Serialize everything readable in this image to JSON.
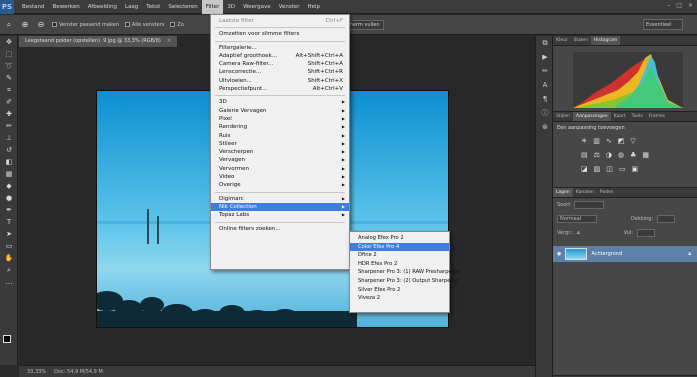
{
  "app": {
    "logo": "PS"
  },
  "menubar": {
    "items": [
      "Bestand",
      "Bewerken",
      "Afbeelding",
      "Laag",
      "Tekst",
      "Selecteren",
      "Filter",
      "3D",
      "Weergave",
      "Venster",
      "Help"
    ],
    "active_index": 6
  },
  "options": {
    "check1": "Venster passend maken",
    "check2": "Alle vensters",
    "check3": "Zo",
    "button": "Scherm vullen",
    "workspace": "Essentieel"
  },
  "document": {
    "tab_title": "Leegstaand polder (opstellen). 9 jpg @ 33,3% (RGB/8)",
    "tab_close": "×"
  },
  "status": {
    "zoom": "33,33%",
    "doc": "Doc: 54,9 M/54,9 M"
  },
  "filter_menu": {
    "items": [
      {
        "label": "Laatste filter",
        "shortcut": "Ctrl+F",
        "disabled": true
      },
      {
        "sep": true
      },
      {
        "label": "Omzetten voor slimme filters"
      },
      {
        "sep": true
      },
      {
        "label": "Filtergalerie..."
      },
      {
        "label": "Adaptief groothoek...",
        "shortcut": "Alt+Shift+Ctrl+A"
      },
      {
        "label": "Camera Raw-filter...",
        "shortcut": "Shift+Ctrl+A"
      },
      {
        "label": "Lenscorrectie...",
        "shortcut": "Shift+Ctrl+R"
      },
      {
        "label": "Uitvloeien...",
        "shortcut": "Shift+Ctrl+X"
      },
      {
        "label": "Perspectiefpunt...",
        "shortcut": "Alt+Ctrl+V"
      },
      {
        "sep": true
      },
      {
        "label": "3D",
        "submenu": true
      },
      {
        "label": "Galerie Vervagen",
        "submenu": true
      },
      {
        "label": "Pixel",
        "submenu": true
      },
      {
        "label": "Rendering",
        "submenu": true
      },
      {
        "label": "Ruis",
        "submenu": true
      },
      {
        "label": "Stileer",
        "submenu": true
      },
      {
        "label": "Verscherpen",
        "submenu": true
      },
      {
        "label": "Vervagen",
        "submenu": true
      },
      {
        "label": "Vervormen",
        "submenu": true
      },
      {
        "label": "Video",
        "submenu": true
      },
      {
        "label": "Overige",
        "submenu": true
      },
      {
        "sep": true
      },
      {
        "label": "Digimarc",
        "submenu": true
      },
      {
        "label": "Nik Collection",
        "submenu": true,
        "highlighted": true
      },
      {
        "label": "Topaz Labs",
        "submenu": true
      },
      {
        "sep": true
      },
      {
        "label": "Online filters zoeken..."
      }
    ]
  },
  "nik_submenu": {
    "items": [
      {
        "label": "Analog Efex Pro 2"
      },
      {
        "label": "Color Efex Pro 4",
        "highlighted": true
      },
      {
        "label": "Dfine 2"
      },
      {
        "label": "HDR Efex Pro 2"
      },
      {
        "label": "Sharpener Pro 3: (1) RAW Presharpener"
      },
      {
        "label": "Sharpener Pro 3: (2) Output Sharpener"
      },
      {
        "label": "Silver Efex Pro 2"
      },
      {
        "label": "Viveza 2"
      }
    ]
  },
  "panels": {
    "top_tabs": [
      "Kleur",
      "Stalen",
      "Histogram"
    ],
    "mid_tabs": [
      "Stijlen",
      "Aanpassingen",
      "Kaart",
      "Tools",
      "Frames"
    ],
    "adj_title": "Een aanpassing toevoegen",
    "layer_tabs": [
      "Lagen",
      "Kanalen",
      "Paden"
    ],
    "kind": "Soort",
    "blend": "Normaal",
    "opacity_label": "Dekking:",
    "fill_label": "Vul:",
    "lock_label": "Vergr.:",
    "layer_name": "Achtergrond"
  }
}
